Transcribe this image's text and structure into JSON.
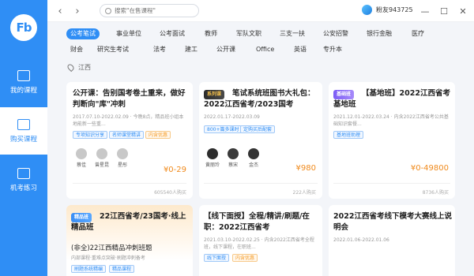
{
  "app": {
    "logo_text": "Fb"
  },
  "sidebar": {
    "items": [
      {
        "label": "我的课程"
      },
      {
        "label": "购买课程"
      },
      {
        "label": "机考练习"
      }
    ]
  },
  "titlebar": {
    "search_placeholder": "搜索\"在售课程\"",
    "username": "粉友943725"
  },
  "categories": {
    "row1": [
      "公考笔试",
      "事业单位",
      "公考面试",
      "教师",
      "军队文职",
      "三支一扶",
      "公安招警",
      "银行金融",
      "医疗"
    ],
    "row2": [
      "财会",
      "研究生考试",
      "法考",
      "建工",
      "公开课",
      "Office",
      "英语",
      "专升本"
    ]
  },
  "location": "江西",
  "cards": [
    {
      "title": "公开课：告别国考卷土重来，做好判断向\"库\"冲刺",
      "meta": "2017.07.10-2022.02.09 · 今晚8点，精品班小组本地能新一些重...",
      "tags": [
        {
          "label": "专项知识分享"
        },
        {
          "label": "名师课堂精讲"
        },
        {
          "label": "内含优惠"
        }
      ],
      "teachers": [
        "蔡佳",
        "曾星昆",
        "星彤"
      ],
      "price": "¥0-29",
      "buyers": "605540人购买"
    },
    {
      "badge": "系列课",
      "title": "笔试系统班图书大礼包：2022江西省考/2023国考",
      "meta": "2022.01.17-2022.03.09",
      "tags": [
        {
          "label": "800+篇多课时"
        },
        {
          "label": "定购买后配套"
        }
      ],
      "teachers": [
        "黄丽玲",
        "蔡宋",
        "金杰"
      ],
      "price": "¥980",
      "buyers": "222人购买"
    },
    {
      "badge": "基础班",
      "title": "【基地班】2022江西省考基地班",
      "meta": "2021.12.01-2022.03.24 · 内含2022江西省考公共基础知识套餐...",
      "tags": [
        {
          "label": "基地班助理"
        }
      ],
      "price": "¥0-49800",
      "buyers": "8736人购买"
    },
    {
      "badge": "精品班",
      "title": "22江西省考/23国考·线上精品班",
      "sub_title": "(非全)22江西精品冲刺班题",
      "sub_meta": "内部课程·重难点突破·刷题冲刺备考",
      "tags": [
        {
          "label": "刷题系统精编"
        },
        {
          "label": "精品课程"
        }
      ]
    },
    {
      "title": "【线下面授】全程/精讲/刷题/在职：2022江西省考",
      "meta": "2021.03.10-2022.02.25 · 内含2022江西省考全程班，线下课程，在职班...",
      "tags": [
        {
          "label": "线下面授"
        },
        {
          "label": "内含优惠"
        }
      ]
    },
    {
      "title": "2022江西省考线下模考大赛线上说明会",
      "meta": "2022.01.06-2022.01.06"
    }
  ],
  "colors": {
    "accent": "#2f8ef5",
    "price": "#f08a1c"
  }
}
